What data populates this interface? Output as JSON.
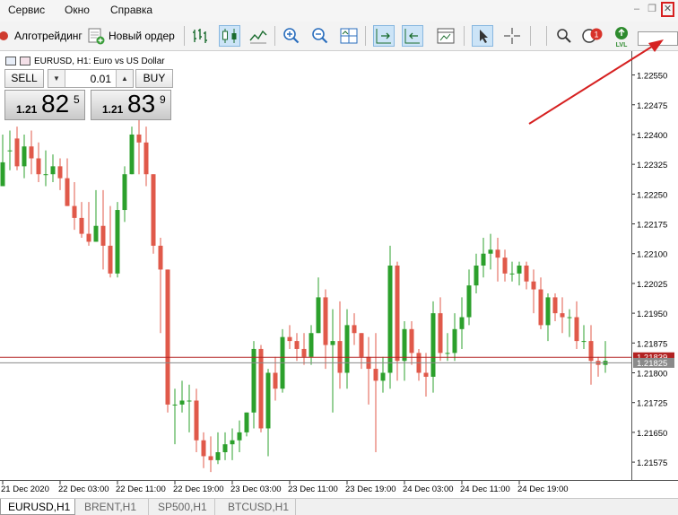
{
  "menu": {
    "items": [
      {
        "label": "Сервис"
      },
      {
        "label": "Окно"
      },
      {
        "label": "Справка"
      }
    ],
    "minimize": "–",
    "restore": "❐",
    "close": "✕"
  },
  "toolbar": {
    "algo_label": "Алготрейдинг",
    "new_order_label": "Новый ордер",
    "notification_count": "1",
    "lvl_label": "LVL"
  },
  "chart": {
    "title": "EURUSD, H1:  Euro vs US Dollar",
    "trade_panel": {
      "sell_label": "SELL",
      "buy_label": "BUY",
      "lot": "0.01",
      "bid_small": "1.21",
      "bid_big": "82",
      "bid_sup": "5",
      "ask_small": "1.21",
      "ask_big": "83",
      "ask_sup": "9"
    },
    "price_labels": [
      "1.22550",
      "1.22475",
      "1.22400",
      "1.22325",
      "1.22250",
      "1.22175",
      "1.22100",
      "1.22025",
      "1.21950",
      "1.21875",
      "1.21800",
      "1.21725",
      "1.21650",
      "1.21575"
    ],
    "bid_line_label": "1.21839",
    "ask_line_label": "1.21825",
    "time_labels": [
      "21 Dec 2020",
      "22 Dec 03:00",
      "22 Dec 11:00",
      "22 Dec 19:00",
      "23 Dec 03:00",
      "23 Dec 11:00",
      "23 Dec 19:00",
      "24 Dec 03:00",
      "24 Dec 11:00",
      "24 Dec 19:00"
    ],
    "colors": {
      "bull": "#2ca02c",
      "bear": "#e0594a",
      "bid_line": "#b22222",
      "ask_line": "#8a8a8a"
    }
  },
  "chart_data": {
    "type": "candlestick",
    "symbol": "EURUSD",
    "timeframe": "H1",
    "ylim": [
      1.2153,
      1.2261
    ],
    "candles": [
      {
        "o": 1.2227,
        "h": 1.224,
        "l": 1.2227,
        "c": 1.2233
      },
      {
        "o": 1.2236,
        "h": 1.2241,
        "l": 1.2231,
        "c": 1.2236
      },
      {
        "o": 1.2239,
        "h": 1.2242,
        "l": 1.2231,
        "c": 1.2232
      },
      {
        "o": 1.2232,
        "h": 1.224,
        "l": 1.2229,
        "c": 1.2237
      },
      {
        "o": 1.2237,
        "h": 1.2241,
        "l": 1.223,
        "c": 1.2234
      },
      {
        "o": 1.2234,
        "h": 1.2238,
        "l": 1.2228,
        "c": 1.223
      },
      {
        "o": 1.223,
        "h": 1.2236,
        "l": 1.2227,
        "c": 1.223
      },
      {
        "o": 1.223,
        "h": 1.2235,
        "l": 1.2228,
        "c": 1.2232
      },
      {
        "o": 1.2232,
        "h": 1.2234,
        "l": 1.2226,
        "c": 1.2229
      },
      {
        "o": 1.2229,
        "h": 1.2234,
        "l": 1.2222,
        "c": 1.2222
      },
      {
        "o": 1.2222,
        "h": 1.2228,
        "l": 1.2216,
        "c": 1.2219
      },
      {
        "o": 1.2219,
        "h": 1.2223,
        "l": 1.2214,
        "c": 1.2215
      },
      {
        "o": 1.2215,
        "h": 1.2223,
        "l": 1.2212,
        "c": 1.2213
      },
      {
        "o": 1.2213,
        "h": 1.2226,
        "l": 1.2213,
        "c": 1.2217
      },
      {
        "o": 1.2217,
        "h": 1.2226,
        "l": 1.2206,
        "c": 1.2212
      },
      {
        "o": 1.2212,
        "h": 1.2222,
        "l": 1.2204,
        "c": 1.2205
      },
      {
        "o": 1.2205,
        "h": 1.2223,
        "l": 1.2204,
        "c": 1.2221
      },
      {
        "o": 1.2221,
        "h": 1.2232,
        "l": 1.2218,
        "c": 1.223
      },
      {
        "o": 1.223,
        "h": 1.2242,
        "l": 1.223,
        "c": 1.224
      },
      {
        "o": 1.224,
        "h": 1.2246,
        "l": 1.223,
        "c": 1.2238
      },
      {
        "o": 1.2238,
        "h": 1.2242,
        "l": 1.2227,
        "c": 1.223
      },
      {
        "o": 1.223,
        "h": 1.223,
        "l": 1.221,
        "c": 1.2212
      },
      {
        "o": 1.2212,
        "h": 1.2214,
        "l": 1.219,
        "c": 1.2206
      },
      {
        "o": 1.2206,
        "h": 1.2206,
        "l": 1.217,
        "c": 1.2172
      },
      {
        "o": 1.2172,
        "h": 1.2176,
        "l": 1.2162,
        "c": 1.2172
      },
      {
        "o": 1.2172,
        "h": 1.2178,
        "l": 1.217,
        "c": 1.2173
      },
      {
        "o": 1.2173,
        "h": 1.2177,
        "l": 1.2165,
        "c": 1.2173
      },
      {
        "o": 1.2173,
        "h": 1.2176,
        "l": 1.216,
        "c": 1.2163
      },
      {
        "o": 1.2163,
        "h": 1.2165,
        "l": 1.2156,
        "c": 1.2159
      },
      {
        "o": 1.2159,
        "h": 1.2164,
        "l": 1.2155,
        "c": 1.2158
      },
      {
        "o": 1.2158,
        "h": 1.2165,
        "l": 1.2157,
        "c": 1.216
      },
      {
        "o": 1.216,
        "h": 1.2165,
        "l": 1.2158,
        "c": 1.2162
      },
      {
        "o": 1.2162,
        "h": 1.2166,
        "l": 1.2158,
        "c": 1.2163
      },
      {
        "o": 1.2163,
        "h": 1.2168,
        "l": 1.216,
        "c": 1.2165
      },
      {
        "o": 1.2165,
        "h": 1.217,
        "l": 1.2164,
        "c": 1.217
      },
      {
        "o": 1.217,
        "h": 1.2188,
        "l": 1.2166,
        "c": 1.2186
      },
      {
        "o": 1.2186,
        "h": 1.2187,
        "l": 1.2165,
        "c": 1.2166
      },
      {
        "o": 1.2166,
        "h": 1.2181,
        "l": 1.2159,
        "c": 1.218
      },
      {
        "o": 1.218,
        "h": 1.2184,
        "l": 1.2173,
        "c": 1.2176
      },
      {
        "o": 1.2176,
        "h": 1.2191,
        "l": 1.2175,
        "c": 1.2189
      },
      {
        "o": 1.2189,
        "h": 1.2192,
        "l": 1.2186,
        "c": 1.2188
      },
      {
        "o": 1.2188,
        "h": 1.219,
        "l": 1.2183,
        "c": 1.2186
      },
      {
        "o": 1.2186,
        "h": 1.219,
        "l": 1.2182,
        "c": 1.2184
      },
      {
        "o": 1.2184,
        "h": 1.2192,
        "l": 1.2182,
        "c": 1.219
      },
      {
        "o": 1.219,
        "h": 1.2204,
        "l": 1.219,
        "c": 1.2199
      },
      {
        "o": 1.2199,
        "h": 1.2201,
        "l": 1.2181,
        "c": 1.2187
      },
      {
        "o": 1.2187,
        "h": 1.2196,
        "l": 1.217,
        "c": 1.2188
      },
      {
        "o": 1.2188,
        "h": 1.2198,
        "l": 1.2176,
        "c": 1.218
      },
      {
        "o": 1.218,
        "h": 1.2196,
        "l": 1.2176,
        "c": 1.2192
      },
      {
        "o": 1.2192,
        "h": 1.2195,
        "l": 1.2187,
        "c": 1.219
      },
      {
        "o": 1.219,
        "h": 1.219,
        "l": 1.2181,
        "c": 1.2184
      },
      {
        "o": 1.2184,
        "h": 1.2189,
        "l": 1.2172,
        "c": 1.2181
      },
      {
        "o": 1.2181,
        "h": 1.219,
        "l": 1.216,
        "c": 1.2178
      },
      {
        "o": 1.2178,
        "h": 1.2184,
        "l": 1.2175,
        "c": 1.218
      },
      {
        "o": 1.218,
        "h": 1.2212,
        "l": 1.2176,
        "c": 1.2207
      },
      {
        "o": 1.2207,
        "h": 1.2208,
        "l": 1.2178,
        "c": 1.2183
      },
      {
        "o": 1.2183,
        "h": 1.2193,
        "l": 1.2178,
        "c": 1.2191
      },
      {
        "o": 1.2191,
        "h": 1.2193,
        "l": 1.2182,
        "c": 1.2185
      },
      {
        "o": 1.2185,
        "h": 1.2186,
        "l": 1.2178,
        "c": 1.218
      },
      {
        "o": 1.218,
        "h": 1.2185,
        "l": 1.2174,
        "c": 1.2179
      },
      {
        "o": 1.2179,
        "h": 1.2198,
        "l": 1.2175,
        "c": 1.2195
      },
      {
        "o": 1.2195,
        "h": 1.2199,
        "l": 1.2183,
        "c": 1.2185
      },
      {
        "o": 1.2185,
        "h": 1.219,
        "l": 1.2183,
        "c": 1.2185
      },
      {
        "o": 1.2185,
        "h": 1.2195,
        "l": 1.2183,
        "c": 1.2191
      },
      {
        "o": 1.2191,
        "h": 1.2199,
        "l": 1.2186,
        "c": 1.2194
      },
      {
        "o": 1.2194,
        "h": 1.2206,
        "l": 1.2192,
        "c": 1.2202
      },
      {
        "o": 1.2202,
        "h": 1.221,
        "l": 1.22,
        "c": 1.2207
      },
      {
        "o": 1.2207,
        "h": 1.2214,
        "l": 1.2204,
        "c": 1.221
      },
      {
        "o": 1.221,
        "h": 1.2215,
        "l": 1.2206,
        "c": 1.2211
      },
      {
        "o": 1.2211,
        "h": 1.2214,
        "l": 1.2203,
        "c": 1.2209
      },
      {
        "o": 1.2209,
        "h": 1.2211,
        "l": 1.2203,
        "c": 1.2205
      },
      {
        "o": 1.2205,
        "h": 1.2208,
        "l": 1.2203,
        "c": 1.2205
      },
      {
        "o": 1.2205,
        "h": 1.2208,
        "l": 1.2202,
        "c": 1.2207
      },
      {
        "o": 1.2207,
        "h": 1.2208,
        "l": 1.2201,
        "c": 1.2203
      },
      {
        "o": 1.2203,
        "h": 1.2206,
        "l": 1.2195,
        "c": 1.2201
      },
      {
        "o": 1.2201,
        "h": 1.2204,
        "l": 1.2191,
        "c": 1.2192
      },
      {
        "o": 1.2192,
        "h": 1.22,
        "l": 1.2188,
        "c": 1.2199
      },
      {
        "o": 1.2199,
        "h": 1.22,
        "l": 1.2193,
        "c": 1.2195
      },
      {
        "o": 1.2195,
        "h": 1.2199,
        "l": 1.219,
        "c": 1.2194
      },
      {
        "o": 1.2194,
        "h": 1.2196,
        "l": 1.2189,
        "c": 1.2194
      },
      {
        "o": 1.2194,
        "h": 1.2198,
        "l": 1.2186,
        "c": 1.2188
      },
      {
        "o": 1.2188,
        "h": 1.2192,
        "l": 1.2186,
        "c": 1.2188
      },
      {
        "o": 1.2188,
        "h": 1.2192,
        "l": 1.2177,
        "c": 1.2183
      },
      {
        "o": 1.2183,
        "h": 1.2184,
        "l": 1.2179,
        "c": 1.2182
      },
      {
        "o": 1.2182,
        "h": 1.2188,
        "l": 1.218,
        "c": 1.2183
      }
    ]
  }
}
